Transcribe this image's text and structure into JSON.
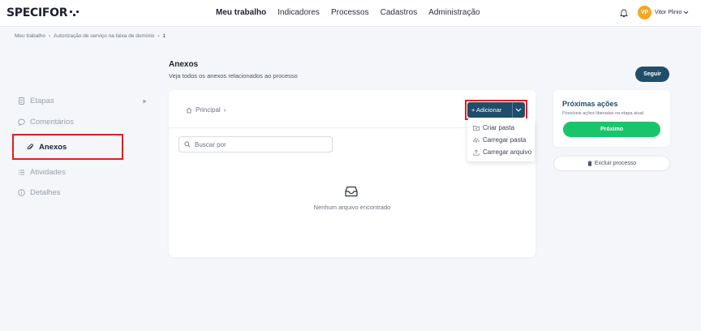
{
  "app": {
    "logo_text": "SPECIFOR"
  },
  "nav": {
    "items": [
      "Meu trabalho",
      "Indicadores",
      "Processos",
      "Cadastros",
      "Administração"
    ],
    "active": "Meu trabalho"
  },
  "user": {
    "initials": "VP",
    "name": "Vitor Plinio"
  },
  "breadcrumb": {
    "items": [
      "Meu trabalho",
      "Autorização de serviço na faixa de domínio",
      "1"
    ]
  },
  "section": {
    "title": "Anexos",
    "subtitle": "Veja todos os anexos relacionados ao processo"
  },
  "follow_button": "Seguir",
  "sidebar": {
    "items": [
      {
        "label": "Etapas",
        "icon": "document-icon"
      },
      {
        "label": "Comentários",
        "icon": "chat-icon"
      },
      {
        "label": "Anexos",
        "icon": "paperclip-icon",
        "active": true
      },
      {
        "label": "Atividades",
        "icon": "list-icon"
      },
      {
        "label": "Detalhes",
        "icon": "info-icon"
      }
    ]
  },
  "files": {
    "path_root": "Principal",
    "add_button": "+ Adicionar",
    "add_menu": [
      "Criar pasta",
      "Carregar pasta",
      "Carregar arquivo"
    ],
    "search_placeholder": "Buscar por",
    "empty_text": "Nenhum arquivo encontrado"
  },
  "next_actions": {
    "title": "Próximas ações",
    "subtitle": "Possíveis ações liberadas na etapa atual",
    "next_button": "Próximo",
    "delete_button": "Excluir processo"
  },
  "colors": {
    "primary": "#1f4e6b",
    "success": "#19c46b",
    "avatar": "#f5a623",
    "highlight": "#e01e1e"
  }
}
